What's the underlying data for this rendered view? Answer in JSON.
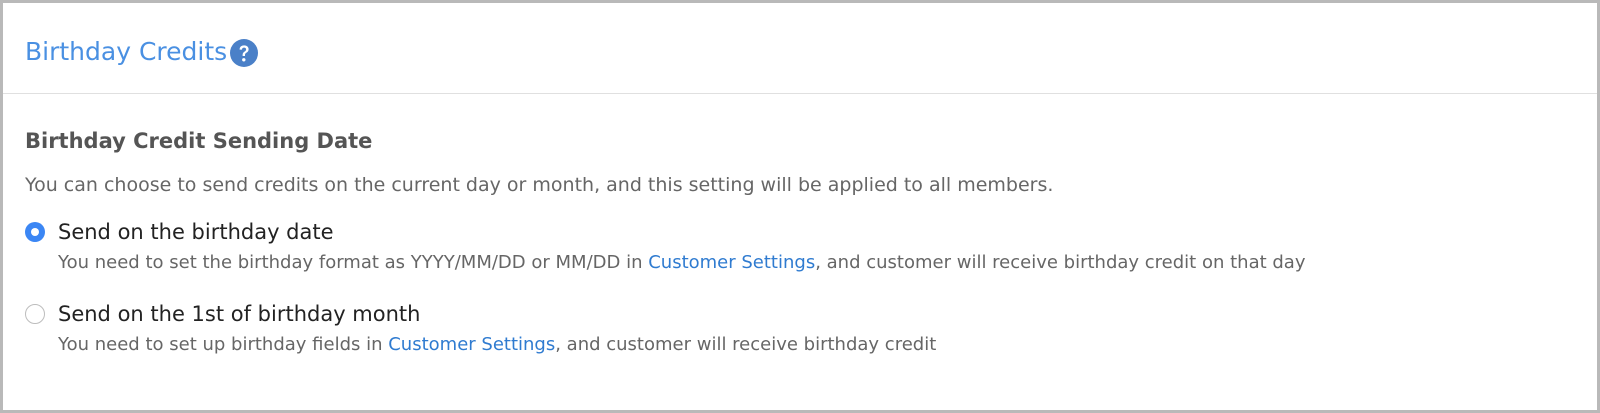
{
  "panel": {
    "title": "Birthday Credits",
    "help_icon": "question-circle-icon"
  },
  "section": {
    "heading": "Birthday Credit Sending Date",
    "description": "You can choose to send credits on the current day or month, and this setting will be applied to all members."
  },
  "options": [
    {
      "label": "Send on the birthday date",
      "checked": true,
      "hint_before": "You need to set the birthday format as YYYY/MM/DD or MM/DD in ",
      "hint_link": "Customer Settings",
      "hint_after": ", and customer will receive birthday credit on that day"
    },
    {
      "label": "Send on the 1st of birthday month",
      "checked": false,
      "hint_before": "You need to set up birthday fields in ",
      "hint_link": "Customer Settings",
      "hint_after": ", and customer will receive birthday credit"
    }
  ],
  "colors": {
    "title": "#4a90e2",
    "radio_checked": "#3b86f4",
    "link": "#2f7bd0"
  }
}
